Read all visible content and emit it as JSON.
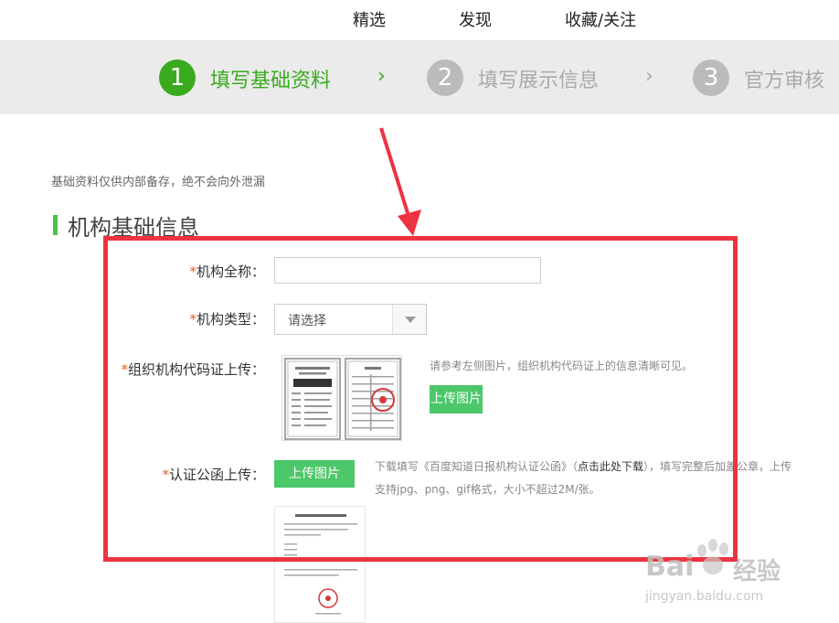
{
  "topnav": {
    "items": [
      "精选",
      "发现",
      "收藏/关注"
    ]
  },
  "steps": [
    {
      "number": "1",
      "label": "填写基础资料",
      "active": true
    },
    {
      "number": "2",
      "label": "填写展示信息",
      "active": false
    },
    {
      "number": "3",
      "label": "官方审核",
      "active": false
    }
  ],
  "step_separator": "›",
  "colors": {
    "active_green": "#3aab1f",
    "inactive_gray": "#bbbbbb",
    "button_green": "#4cc76a",
    "required_star": "#e85c27",
    "highlight_red": "#ee3340"
  },
  "form": {
    "note": "基础资料仅供内部备存，绝不会向外泄漏",
    "section_title": "机构基础信息",
    "required_mark": "*",
    "fields": {
      "org_name": {
        "label": "机构全称：",
        "value": ""
      },
      "org_type": {
        "label": "机构类型：",
        "selected": "请选择"
      },
      "org_code": {
        "label": "组织机构代码证上传：",
        "hint": "请参考左侧图片，组织机构代码证上的信息清晰可见。",
        "button": "上传图片"
      },
      "letter": {
        "label": "认证公函上传：",
        "button": "上传图片",
        "hint_prefix": "下载填写《百度知道日报机构认证公函》（",
        "hint_link": "点击此处下载",
        "hint_suffix": "），填写完整后加盖公章，上传",
        "hint_line2": "支持jpg、png、gif格式，大小不超过2M/张。"
      }
    }
  },
  "watermark": {
    "logo_text": "Bai",
    "logo_cn": "经验",
    "url": "jingyan.baidu.com"
  }
}
